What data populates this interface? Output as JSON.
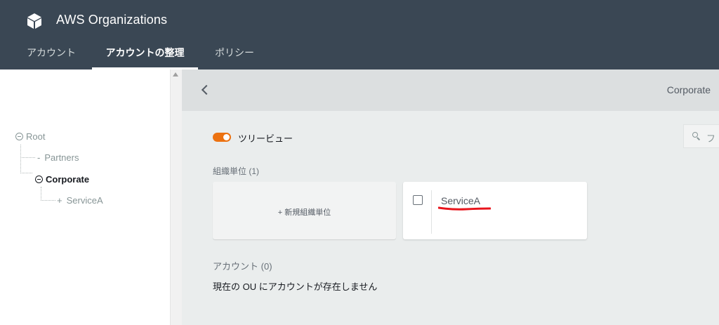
{
  "header": {
    "app_title": "AWS Organizations",
    "logo_icon": "cube-icon",
    "tabs": [
      {
        "label": "アカウント",
        "active": false
      },
      {
        "label": "アカウントの整理",
        "active": true
      },
      {
        "label": "ポリシー",
        "active": false
      }
    ]
  },
  "tree": {
    "nodes": [
      {
        "label": "Root",
        "icon": "collapse-circle-icon",
        "selected": false
      },
      {
        "label": "Partners",
        "icon": "dash-icon",
        "selected": false
      },
      {
        "label": "Corporate",
        "icon": "collapse-circle-icon",
        "selected": true
      },
      {
        "label": "ServiceA",
        "icon": "plus-icon",
        "selected": false
      }
    ]
  },
  "main": {
    "current_ou": "Corporate",
    "tree_view_label": "ツリービュー",
    "tree_view_on": true,
    "search_placeholder": "フ",
    "ou_section": {
      "label": "組織単位",
      "count": "(1)"
    },
    "new_ou_label": "+ 新規組織単位",
    "ou_cards": [
      {
        "name": "ServiceA"
      }
    ],
    "account_section": {
      "label": "アカウント",
      "count": "(0)"
    },
    "no_accounts_text": "現在の OU にアカウントが存在しません"
  },
  "colors": {
    "header_bg": "#3a4754",
    "accent_orange": "#ec7211",
    "annotation_red": "#e8141c",
    "main_bg": "#eaeded"
  }
}
